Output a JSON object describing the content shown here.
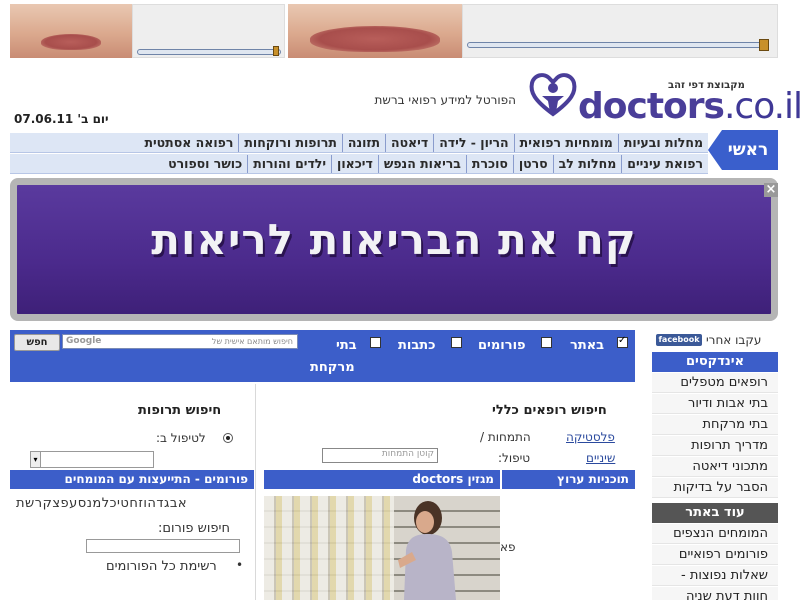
{
  "header": {
    "logo_text": "doctors",
    "logo_tld": ".co.il",
    "logo_group": "מקבוצת דפי זהב",
    "tagline": "הפורטל למידע רפואי ברשת",
    "date": "יום ב' 07.06.11"
  },
  "nav": {
    "home_label": "ראשי",
    "row1": [
      "מחלות ובעיות",
      "מומחיות רפואית",
      "הריון - לידה",
      "דיאטה",
      "תזונה",
      "תרופות ורוקחות",
      "רפואה אסתטית"
    ],
    "row2": [
      "רפואת עיניים",
      "מחלות לב",
      "סרטן",
      "סוכרת",
      "בריאות הנפש",
      "דיכאון",
      "ילדים והורות",
      "כושר וספורט"
    ]
  },
  "ad": {
    "text": "קח את הבריאות לריאות",
    "close_label": "×"
  },
  "search": {
    "button_label": "חפש",
    "placeholder": "חיפוש מותאם אישית של",
    "brand": "Google",
    "options": [
      {
        "label": "באתר",
        "checked": true
      },
      {
        "label": "פורומים",
        "checked": false
      },
      {
        "label": "כתבות",
        "checked": false
      },
      {
        "label": "בתי",
        "checked": false
      }
    ],
    "options_cont": "מרקחת"
  },
  "sidebar": {
    "follow_label": "עקבו אחרי",
    "facebook_label": "facebook",
    "index_title": "אינדקסים",
    "index_items": [
      "רופאים מטפלים",
      "בתי אבות ודיור",
      "בתי מרקחת",
      "מדריך תרופות",
      "מתכוני דיאטה",
      "הסבר על בדיקות"
    ],
    "more_title": "עוד באתר",
    "more_items": [
      "המומחים הנצפים",
      "פורומים רפואיים",
      "שאלות נפוצות -",
      "חוות דעת שניה"
    ]
  },
  "doctor_search": {
    "title": "חיפוש רופאים כללי",
    "specialty_label": "התמחות /",
    "treatment_label": "טיפול:",
    "link_plastic": "פלסטיקה",
    "link_teeth": "שיניים",
    "input_placeholder": "קוטן התמחות"
  },
  "drug_search": {
    "title": "חיפוש תרופות",
    "radio_label": "לטיפול ב:",
    "dropdown_value": ""
  },
  "forums": {
    "title": "פורומים - התייעצות עם המומחים",
    "letters": "אבגדהוזחטיכלמנסעפצקרשת",
    "search_label": "חיפוש פורום:",
    "list_label": "רשימת כל הפורומים"
  },
  "bars": {
    "magazine": "מגזין doctors",
    "tv": "תוכניות ערוץ",
    "partial_text": "פא"
  }
}
